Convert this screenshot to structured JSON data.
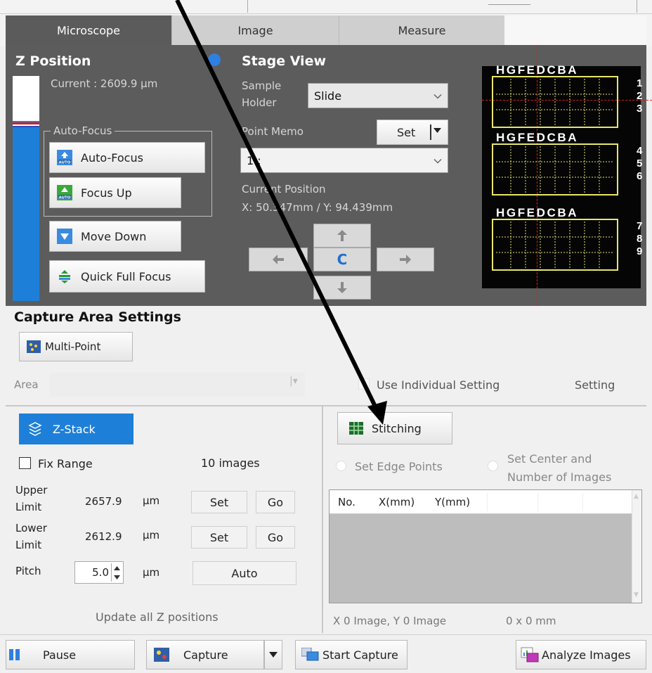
{
  "tabs": [
    {
      "label": "Microscope"
    },
    {
      "label": "Image"
    },
    {
      "label": "Measure"
    }
  ],
  "zpos": {
    "title": "Z Position",
    "current": "Current : 2609.9 μm",
    "autofocus_group": "Auto-Focus",
    "autofocus_button": "Auto-Focus",
    "focus_up_button": "Focus Up",
    "move_down_button": "Move Down",
    "quick_full_focus_button": "Quick Full Focus",
    "auto_badge": "AUTO"
  },
  "stage": {
    "title": "Stage View",
    "sample_holder_label_1": "Sample",
    "sample_holder_label_2": "Holder",
    "sample_holder_value": "Slide",
    "point_memo_label": "Point Memo",
    "point_memo_set": "Set",
    "point_memo_value": "1 :",
    "current_position_label": "Current Position",
    "current_position_value": "X: 50.347mm / Y: 94.439mm",
    "center_label": "C"
  },
  "slide_map": {
    "columns": "HGFEDCBA",
    "rows": [
      [
        "1",
        "2",
        "3"
      ],
      [
        "4",
        "5",
        "6"
      ],
      [
        "7",
        "8",
        "9"
      ]
    ]
  },
  "capture_area": {
    "title": "Capture Area Settings",
    "multipoint_button": "Multi-Point",
    "area_label": "Area",
    "use_individual_setting": "Use Individual Setting",
    "setting_label": "Setting"
  },
  "zstack": {
    "button": "Z-Stack",
    "fix_range": "Fix Range",
    "image_count": "10 images",
    "upper_limit_1": "Upper",
    "upper_limit_2": "Limit",
    "upper_value": "2657.9",
    "lower_limit_1": "Lower",
    "lower_limit_2": "Limit",
    "lower_value": "2612.9",
    "unit": "μm",
    "set": "Set",
    "go": "Go",
    "pitch_label": "Pitch",
    "pitch_value": "5.0",
    "auto": "Auto",
    "update_all": "Update all Z positions"
  },
  "stitching": {
    "button": "Stitching",
    "set_edge_points": "Set Edge Points",
    "set_center_1": "Set Center and",
    "set_center_2": "Number of Images",
    "columns": [
      "No.",
      "X(mm)",
      "Y(mm)"
    ],
    "summary_images": "X 0 Image, Y 0 Image",
    "summary_size": "0 x 0 mm"
  },
  "bottom_bar": {
    "pause": "Pause",
    "capture": "Capture",
    "start_capture": "Start Capture",
    "analyze_images": "Analyze Images"
  },
  "colors": {
    "accent_blue": "#1e7fd8",
    "dark_panel": "#5c5c5c",
    "slide_yellow": "#e8e66a",
    "annotation_red": "#d42020"
  }
}
